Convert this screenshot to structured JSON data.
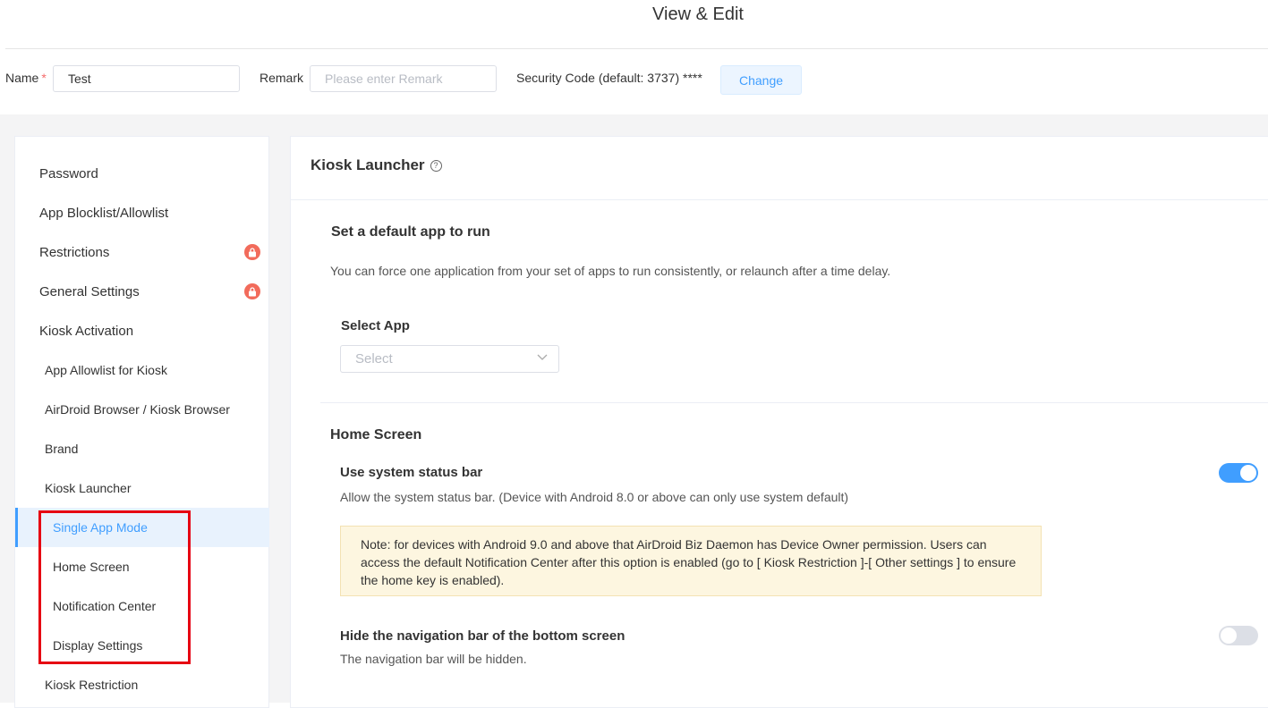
{
  "header": {
    "title": "View & Edit",
    "name_label": "Name",
    "required_mark": "*",
    "name_value": "Test",
    "remark_label": "Remark",
    "remark_placeholder": "Please enter Remark",
    "security_code_text": "Security Code (default: 3737) ****",
    "change_label": "Change"
  },
  "sidebar": {
    "items": [
      {
        "label": "Password"
      },
      {
        "label": "App Blocklist/Allowlist"
      },
      {
        "label": "Restrictions",
        "badge": "lock-icon"
      },
      {
        "label": "General Settings",
        "badge": "lock-icon"
      },
      {
        "label": "Kiosk Activation"
      },
      {
        "label": "App Allowlist for Kiosk"
      },
      {
        "label": "AirDroid Browser / Kiosk Browser"
      },
      {
        "label": "Brand"
      },
      {
        "label": "Kiosk Launcher"
      },
      {
        "label": "Single App Mode",
        "active": true
      },
      {
        "label": "Home Screen"
      },
      {
        "label": "Notification Center"
      },
      {
        "label": "Display Settings"
      },
      {
        "label": "Kiosk Restriction"
      }
    ],
    "accent_color": "#409eff",
    "highlight_color": "#e60012"
  },
  "main": {
    "title": "Kiosk Launcher",
    "help_icon": "question-circle-icon",
    "default_app": {
      "title": "Set a default app to run",
      "description": "You can force one application from your set of apps to run consistently, or relaunch after a time delay.",
      "select_label": "Select App",
      "select_placeholder": "Select"
    },
    "home_screen": {
      "title": "Home Screen",
      "status_bar": {
        "title": "Use system status bar",
        "description": "Allow the system status bar. (Device with Android 8.0 or above can only use system default)",
        "enabled": true
      },
      "note": "Note: for devices with Android 9.0 and above that AirDroid Biz Daemon has Device Owner permission. Users can access the default Notification Center after this option is enabled (go to [ Kiosk Restriction ]-[ Other settings ] to ensure the home key is enabled).",
      "nav_bar": {
        "title": "Hide the navigation bar of the bottom screen",
        "description": "The navigation bar will be hidden.",
        "enabled": false
      }
    }
  }
}
